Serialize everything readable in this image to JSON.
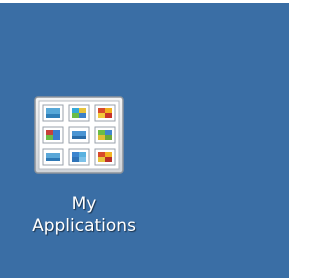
{
  "desktop": {
    "background": "#3a6ea5",
    "icons": [
      {
        "id": "my-applications",
        "icon": "applications-grid-icon",
        "label_line1": "My",
        "label_line2": "Applications"
      }
    ]
  }
}
